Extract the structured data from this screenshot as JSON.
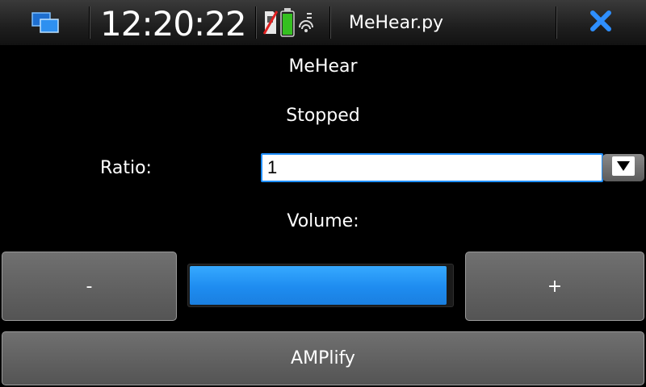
{
  "statusbar": {
    "clock": "12:20:22",
    "app_title": "MeHear.py",
    "icons": {
      "task_switcher": "task-switcher-icon",
      "sim": "no-sim-icon",
      "battery": "battery-icon",
      "signal": "signal-icon",
      "close": "close-icon"
    }
  },
  "main": {
    "app_name": "MeHear",
    "status": "Stopped",
    "ratio_label": "Ratio:",
    "ratio_value": "1",
    "volume_label": "Volume:",
    "volume_level": 0.98,
    "minus_label": "-",
    "plus_label": "+",
    "amplify_label": "AMPlify"
  },
  "colors": {
    "accent": "#1e8cf0",
    "focus": "#1f8fff",
    "background": "#000000"
  }
}
